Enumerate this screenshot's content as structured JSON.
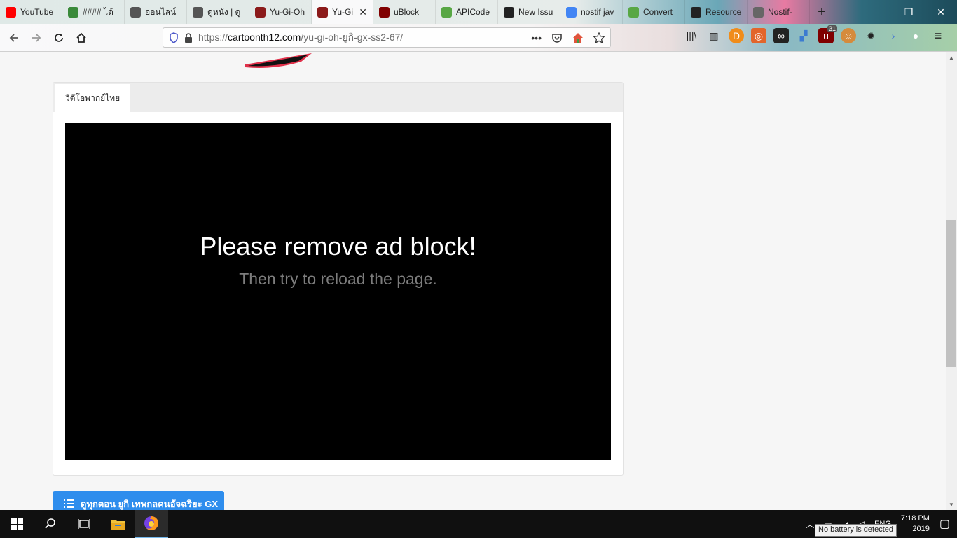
{
  "browser": {
    "tabs": [
      {
        "label": "YouTube",
        "icon": "youtube-icon",
        "color": "#ff0000"
      },
      {
        "label": "#### ได้",
        "icon": "page-icon",
        "color": "#3a8a3a"
      },
      {
        "label": "ออนไลน์",
        "icon": "owl-icon",
        "color": "#555555"
      },
      {
        "label": "ดูหนัง | ดู",
        "icon": "owl-icon",
        "color": "#555555"
      },
      {
        "label": "Yu-Gi-Oh",
        "icon": "yugioh-icon",
        "color": "#8b1a1a"
      },
      {
        "label": "Yu-Gi",
        "icon": "yugioh-icon",
        "color": "#8b1a1a",
        "active": true
      },
      {
        "label": "uBlock",
        "icon": "ublock-icon",
        "color": "#800000"
      },
      {
        "label": "APICode",
        "icon": "code-icon",
        "color": "#58a744"
      },
      {
        "label": "New Issu",
        "icon": "github-icon",
        "color": "#222222"
      },
      {
        "label": "nostif jav",
        "icon": "google-icon",
        "color": "#4285f4"
      },
      {
        "label": "Convert",
        "icon": "code-icon",
        "color": "#58a744"
      },
      {
        "label": "Resource",
        "icon": "github-icon",
        "color": "#222222"
      },
      {
        "label": "Nostif-",
        "icon": "page-icon",
        "color": "#666666"
      }
    ],
    "new_tab_symbol": "+",
    "window_controls": {
      "minimize": "—",
      "restore": "❐",
      "close": "✕"
    },
    "url": {
      "prefix": "https://",
      "host": "cartoonth12.com",
      "path": "/yu-gi-oh-ยูกิ-gx-ss2-67/"
    },
    "toolbar_badge": "31"
  },
  "page": {
    "player_tab_label": "วีดีโอพากย์ไทย",
    "video_title": "Please remove ad block!",
    "video_subtitle": "Then try to reload the page.",
    "episodes_button": "ดูทุกตอน ยูกิ เทพกลคนอัจฉริยะ GX"
  },
  "taskbar": {
    "language": "ENG",
    "time": "7:18 PM",
    "date_partial": "2019",
    "tooltip": "No battery is detected"
  },
  "colors": {
    "accent_button": "#2e8ded",
    "video_bg": "#000000",
    "subtitle_text": "#7d7d7d"
  }
}
